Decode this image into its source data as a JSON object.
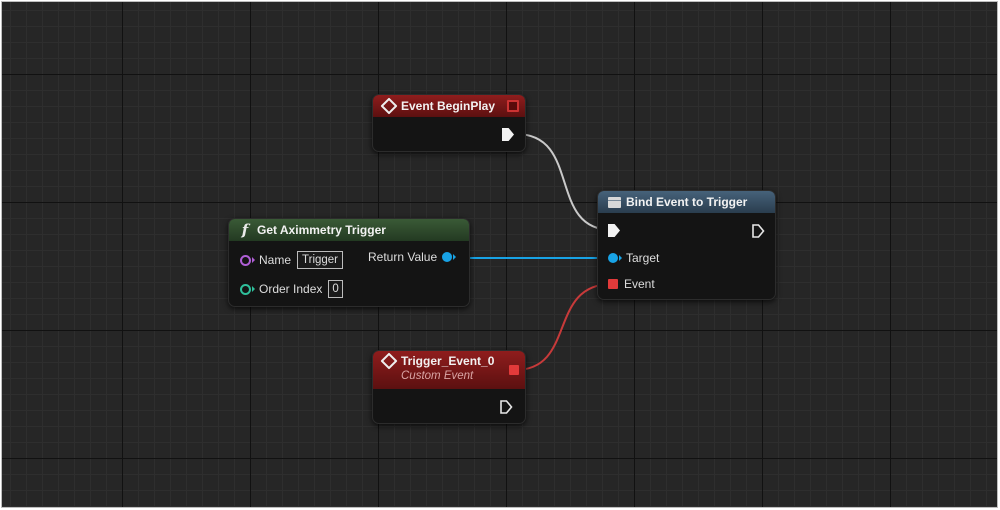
{
  "graph": {
    "nodes": {
      "event_begin_play": {
        "title": "Event BeginPlay",
        "icon": "event-diamond-icon"
      },
      "get_aximmetry_trigger": {
        "title": "Get Aximmetry Trigger",
        "icon": "function-f-icon",
        "inputs": [
          {
            "label": "Name",
            "value": "Trigger"
          },
          {
            "label": "Order Index",
            "value": "0"
          }
        ],
        "output_label": "Return Value"
      },
      "bind_event_to_trigger": {
        "title": "Bind Event to Trigger",
        "icon": "function-icon",
        "inputs": [
          {
            "label": "Target"
          },
          {
            "label": "Event"
          }
        ]
      },
      "trigger_event_0": {
        "title": "Trigger_Event_0",
        "subtitle": "Custom Event",
        "icon": "event-diamond-icon"
      }
    },
    "colors": {
      "event_header": "#8f1d1d",
      "function_header": "#3a5a36",
      "bind_header": "#46627a",
      "exec_wire": "#c9c9c9",
      "object_wire": "#18a3e6",
      "delegate_wire": "#d23b3b",
      "name_pin": "#b05fd6",
      "int_pin": "#2fbf9b"
    }
  }
}
